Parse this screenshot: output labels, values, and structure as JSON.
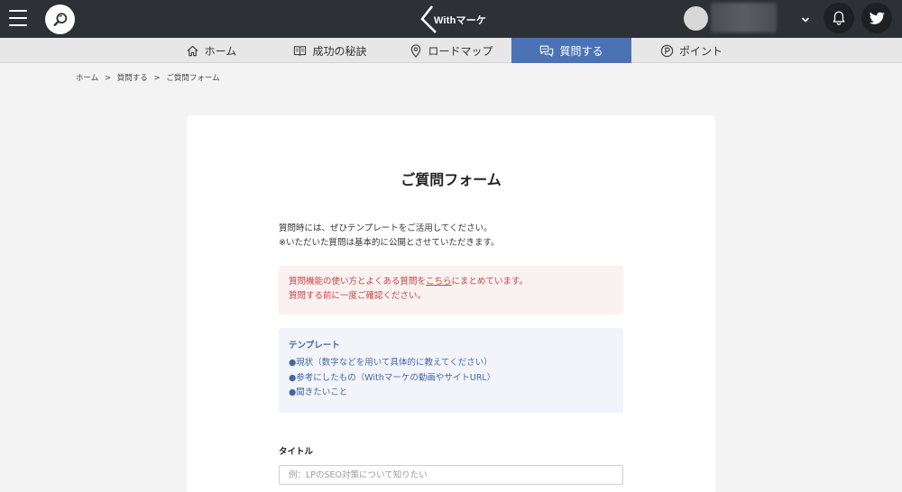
{
  "header": {
    "logo_text": "Withマーケ",
    "icons": {
      "menu": "hamburger-menu-icon",
      "search": "search-icon",
      "dropdown": "chevron-down-icon",
      "notification": "bell-icon",
      "social": "twitter-icon"
    }
  },
  "nav": {
    "items": [
      {
        "label": "ホーム",
        "icon": "home-icon"
      },
      {
        "label": "成功の秘訣",
        "icon": "book-icon"
      },
      {
        "label": "ロードマップ",
        "icon": "map-pin-icon"
      },
      {
        "label": "質問する",
        "icon": "chat-icon"
      },
      {
        "label": "ポイント",
        "icon": "point-coin-icon"
      }
    ],
    "active_label": "質問する"
  },
  "breadcrumb": {
    "items": [
      "ホーム",
      "質問する",
      "ご質問フォーム"
    ],
    "separator": ">"
  },
  "form": {
    "title": "ご質問フォーム",
    "intro_line1": "質問時には、ぜひテンプレートをご活用してください。",
    "intro_line2": "※いただいた質問は基本的に公開とさせていただきます。",
    "notice_pre": "質問機能の使い方とよくある質問を",
    "notice_link": "こちら",
    "notice_post": "にまとめています。",
    "notice_line2": "質問する前に一度ご確認ください。",
    "template_title": "テンプレート",
    "template_items": [
      "●現状（数字などを用いて具体的に教えてください）",
      "●参考にしたもの（Withマーケの動画やサイトURL）",
      "●聞きたいこと"
    ],
    "title_label": "タイトル",
    "title_placeholder": "例：LPのSEO対策について知りたい",
    "title_value": ""
  },
  "colors": {
    "header_bg": "#2d3035",
    "nav_bg": "#e7e7e7",
    "nav_active": "#4b72b4",
    "notice_text": "#c64545",
    "notice_bg": "#faf1f1",
    "template_text": "#4567a8",
    "template_bg": "#f2f4f9"
  }
}
